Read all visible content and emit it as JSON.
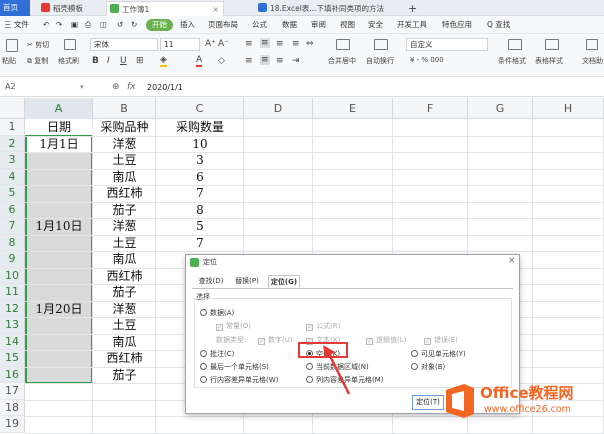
{
  "tabs": {
    "home": "首页",
    "t1": "稻壳模板",
    "t2": "工作簿1",
    "t3": "18.Excel表...下填补同类项的方法",
    "new": "+"
  },
  "menu": {
    "file": "三 文件",
    "items": [
      "开始",
      "插入",
      "页面布局",
      "公式",
      "数据",
      "审阅",
      "视图",
      "安全",
      "开发工具",
      "特色应用"
    ],
    "search": "Q 查找"
  },
  "toolbar": {
    "paste": "粘贴",
    "cut": "剪切",
    "copy": "复制",
    "format_painter": "格式刷",
    "font_name": "宋体",
    "font_size": "11",
    "merge": "合并居中",
    "wrap": "自动换行",
    "number_format": "自定义",
    "percent": "¥ - % 000",
    "cond_format": "条件格式",
    "table_style": "表格样式",
    "text_tool": "文档助"
  },
  "formula_bar": {
    "name_box": "A2",
    "fx": "fx",
    "value": "2020/1/1"
  },
  "grid": {
    "columns": [
      "A",
      "B",
      "C",
      "D",
      "E",
      "F",
      "G",
      "H"
    ],
    "rows": [
      "1",
      "2",
      "3",
      "4",
      "5",
      "6",
      "7",
      "8",
      "9",
      "10",
      "11",
      "12",
      "13",
      "14",
      "15",
      "16",
      "17",
      "18",
      "19"
    ],
    "cells": {
      "A1": "日期",
      "B1": "采购品种",
      "C1": "采购数量",
      "A2": "1月1日",
      "B2": "洋葱",
      "C2": "10",
      "B3": "土豆",
      "C3": "3",
      "B4": "南瓜",
      "C4": "6",
      "B5": "西红柿",
      "C5": "7",
      "B6": "茄子",
      "C6": "8",
      "A7": "1月10日",
      "B7": "洋葱",
      "C7": "5",
      "B8": "土豆",
      "C8": "7",
      "B9": "南瓜",
      "B10": "西红柿",
      "B11": "茄子",
      "A12": "1月20日",
      "B12": "洋葱",
      "B13": "土豆",
      "B14": "南瓜",
      "B15": "西红柿",
      "B16": "茄子"
    }
  },
  "dialog": {
    "title": "定位",
    "tabs": [
      "查找(D)",
      "替换(P)",
      "定位(G)"
    ],
    "group": "选择",
    "options": {
      "data": "数据(A)",
      "constant": "常量(O)",
      "formula": "公式(R)",
      "data_type": "数据类型:",
      "number": "数字(U)",
      "text": "文本(X)",
      "logical": "逻辑值(L)",
      "error": "错误(E)",
      "comment": "批注(C)",
      "blank": "空值(K)",
      "visible": "可见单元格(Y)",
      "last_cell": "最后一个单元格(S)",
      "current_region": "当前数据区域(N)",
      "object": "对象(B)",
      "row_diff": "行内容差异单元格(W)",
      "col_diff": "列内容差异单元格(M)"
    },
    "ok": "定位(T)"
  },
  "watermark": {
    "brand": "Office教程网",
    "url": "www.office26.com"
  },
  "colors": {
    "accent_green": "#6ab04c",
    "selection_fill": "#d9d9d9",
    "arrow_red": "#e53935",
    "logo_orange": "#f26522"
  }
}
